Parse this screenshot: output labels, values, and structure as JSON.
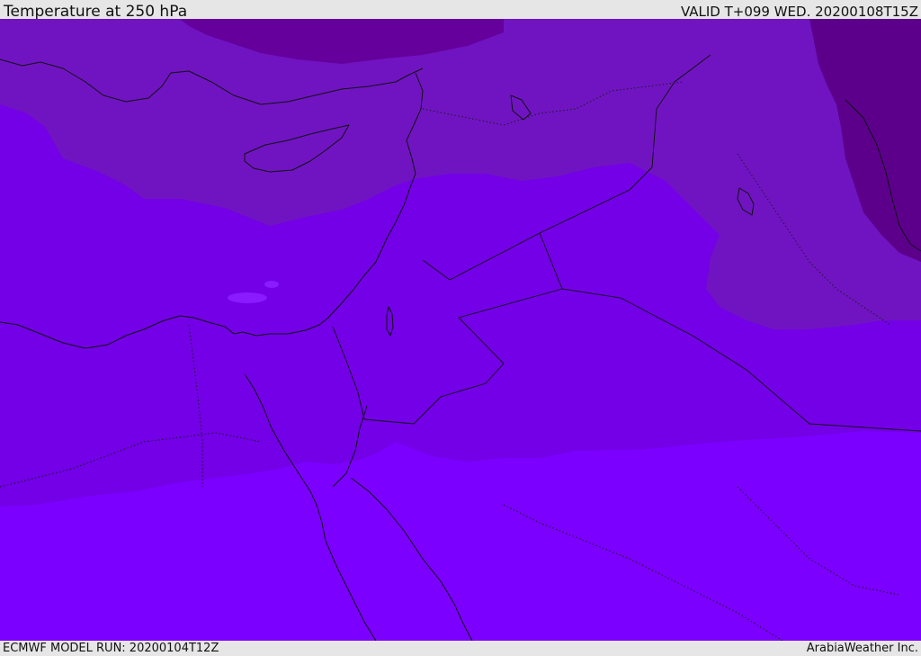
{
  "header": {
    "title": "Temperature at 250 hPa",
    "valid": "VALID T+099 WED. 20200108T15Z"
  },
  "footer": {
    "model_run": "ECMWF MODEL RUN: 20200104T12Z",
    "credit": "ArabiaWeather Inc."
  },
  "colors": {
    "band_warmest": "#7b00ff",
    "band_mid": "#7300e6",
    "band_cool": "#7014c2",
    "band_cold": "#65009c",
    "band_coldest": "#5c008c",
    "patch_light": "#8a1aff",
    "coastline": "#111111"
  }
}
